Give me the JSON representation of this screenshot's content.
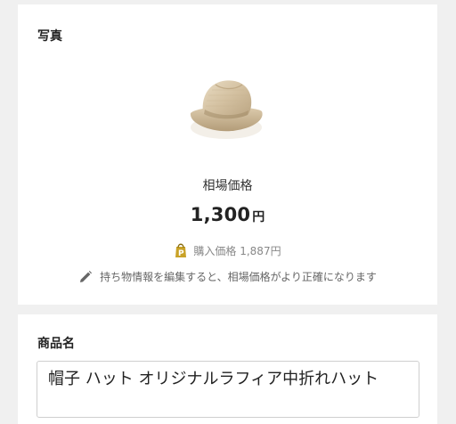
{
  "photo_section": {
    "title": "写真",
    "image_icon": "hat-photo",
    "price_label": "相場価格",
    "price_value": "1,300",
    "price_unit": "円",
    "purchase_text": "購入価格 1,887円",
    "hint_text": "持ち物情報を編集すると、相場価格がより正確になります"
  },
  "name_section": {
    "title": "商品名",
    "value": "帽子 ハット オリジナルラフィア中折れハット"
  },
  "colors": {
    "background": "#f0f0f0",
    "card": "#ffffff",
    "tag_icon": "#c9a227"
  }
}
